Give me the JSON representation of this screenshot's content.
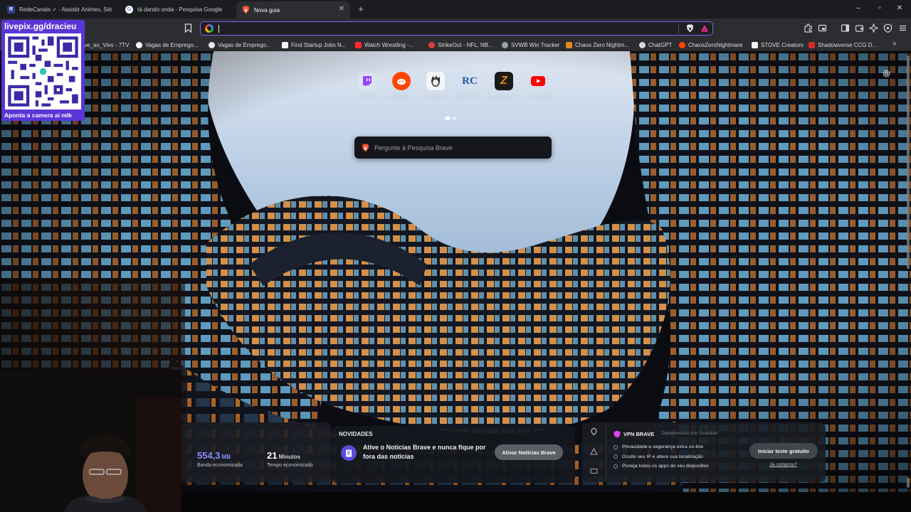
{
  "browser": {
    "tabs": [
      {
        "title": "RedeCanais ✓ - Assistir Animes, Sér",
        "icon": "redecanais-icon",
        "active": false
      },
      {
        "title": "tá dando onda - Pesquisa Google",
        "icon": "google-icon",
        "active": false
      },
      {
        "title": "Nova guia",
        "icon": "brave-lion-icon",
        "active": true
      }
    ],
    "new_tab_label": "+",
    "window_controls": {
      "minimize": "–",
      "restore": "▫",
      "close": "✕"
    },
    "omnibox": {
      "value": "",
      "placeholder": ""
    },
    "accent_color": "#7a64e8"
  },
  "bookmarks": [
    {
      "label": "ve_ao_Vivo - 7TV",
      "icon": "7tv-icon",
      "color": "#2b2b2b"
    },
    {
      "label": "Vagas de Emprego...",
      "icon": "globe-icon",
      "color": "#ffffff"
    },
    {
      "label": "Vagas de Emprego...",
      "icon": "globe-icon",
      "color": "#e8e8e8"
    },
    {
      "label": "Find Startup Jobs N...",
      "icon": "bookmark-page-icon",
      "color": "#f4f4f4"
    },
    {
      "label": "Watch Wrestling -...",
      "icon": "youtube-icon",
      "color": "#ff2a2a"
    },
    {
      "label": "StrikeOut - NFL, NB...",
      "icon": "strikeout-icon",
      "color": "#e23b3b"
    },
    {
      "label": "SVWB Win Tracker",
      "icon": "svwb-icon",
      "color": "#9aa0aa"
    },
    {
      "label": "Chaos Zero Nightm...",
      "icon": "chaos-zero-icon",
      "color": "#e48a1c"
    },
    {
      "label": "ChatGPT",
      "icon": "chatgpt-icon",
      "color": "#d8d8d8"
    },
    {
      "label": "ChaosZeroNightmare",
      "icon": "reddit-icon",
      "color": "#ff4500"
    },
    {
      "label": "STOVE Creators",
      "icon": "stove-icon",
      "color": "#f2f2f2"
    },
    {
      "label": "Shadowverse CCG D...",
      "icon": "shadowverse-icon",
      "color": "#d22a2a"
    }
  ],
  "new_tab_page": {
    "top_sites": [
      {
        "label": "Twitch",
        "icon": "twitch-icon",
        "color": "#9146ff"
      },
      {
        "label": "ChaosZero...",
        "icon": "reddit-icon",
        "color": "#ff4500"
      },
      {
        "label": "Ye Shungu...",
        "icon": "anime-avatar-icon",
        "color": "#f0f0f0"
      },
      {
        "label": "mapa filme...",
        "icon": "rc-icon",
        "color": "#1a5aa8"
      },
      {
        "label": "Chaos Zero...",
        "icon": "chaos-zero-icon",
        "color": "#e48a1c"
      },
      {
        "label": "(1) YouTube",
        "icon": "youtube-icon",
        "color": "#ff0000"
      }
    ],
    "search": {
      "placeholder": "Pergunte à Pesquisa Brave"
    },
    "stats": {
      "bandwidth": {
        "value": "554,3",
        "unit": "MB",
        "label": "Banda economizada"
      },
      "time": {
        "value": "21",
        "unit": "Minutos",
        "label": "Tempo economizado"
      }
    },
    "news": {
      "title": "NOVIDADES",
      "text": "Ative o Notícias Brave e nunca fique por fora das notícias",
      "button": "Ativar Notícias Brave"
    },
    "vpn": {
      "title": "VPN BRAVE",
      "developer": "Desenvolvido por Guardian",
      "features": [
        "Privacidade e segurança extra on-line",
        "Oculte seu IP e altere sua localização",
        "Proteja todos os apps do seu dispositivo"
      ],
      "button": "Iniciar teste gratuito",
      "link": "Já comprou?"
    }
  },
  "stream_overlay": {
    "qr_title": "livepix.gg/dracieu",
    "qr_caption": "Aponta a camera ai mlk",
    "panel_color": "#5a35d8"
  }
}
